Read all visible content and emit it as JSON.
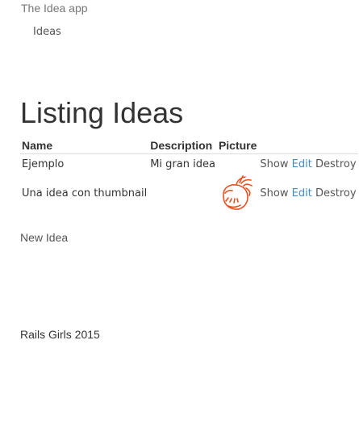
{
  "navbar": {
    "brand": "The Idea app",
    "link": "Ideas"
  },
  "page_title": "Listing Ideas",
  "table": {
    "headers": [
      "Name",
      "Description",
      "Picture"
    ],
    "rows": [
      {
        "name": "Ejemplo",
        "description": "Mi gran idea",
        "has_picture": false
      },
      {
        "name": "Una idea con thumbnail",
        "description": "",
        "has_picture": true,
        "picture_icon": "cartoon-face-thumbnail"
      }
    ],
    "actions": {
      "show": "Show",
      "edit": "Edit",
      "destroy": "Destroy"
    }
  },
  "new_link": "New Idea",
  "footer": "Rails Girls 2015",
  "colors": {
    "link": "#428bca",
    "thumbnail_stroke": "#e8501f"
  }
}
